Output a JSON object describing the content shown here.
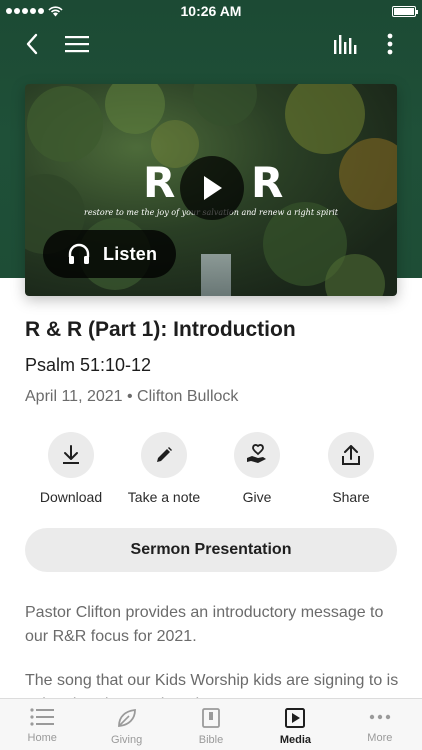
{
  "status_bar": {
    "time": "10:26 AM"
  },
  "media": {
    "title_letters": [
      "R",
      "R"
    ],
    "verse_line": "restore to me the joy of your salvation and renew a right spirit",
    "listen_label": "Listen"
  },
  "sermon": {
    "title": "R & R (Part 1): Introduction",
    "scripture": "Psalm 51:10-12",
    "date_speaker": "April 11, 2021 • Clifton Bullock"
  },
  "actions": [
    {
      "label": "Download",
      "icon": "download-icon"
    },
    {
      "label": "Take a note",
      "icon": "pencil-icon"
    },
    {
      "label": "Give",
      "icon": "give-hand-heart-icon"
    },
    {
      "label": "Share",
      "icon": "share-icon"
    }
  ],
  "presentation_button": "Sermon Presentation",
  "description": [
    "Pastor Clifton provides an introductory message to our R&R focus for 2021.",
    "The song that our Kids Worship kids are signing to is \"Rise\" by Shane Edwards"
  ],
  "tabs": [
    {
      "label": "Home",
      "icon": "list-icon",
      "active": false
    },
    {
      "label": "Giving",
      "icon": "leaf-icon",
      "active": false
    },
    {
      "label": "Bible",
      "icon": "bible-icon",
      "active": false
    },
    {
      "label": "Media",
      "icon": "media-play-icon",
      "active": true
    },
    {
      "label": "More",
      "icon": "more-dots-icon",
      "active": false
    }
  ],
  "colors": {
    "header_green": "#1f5038",
    "chip_gray": "#ebebeb",
    "muted_text": "#6b6b6b"
  }
}
